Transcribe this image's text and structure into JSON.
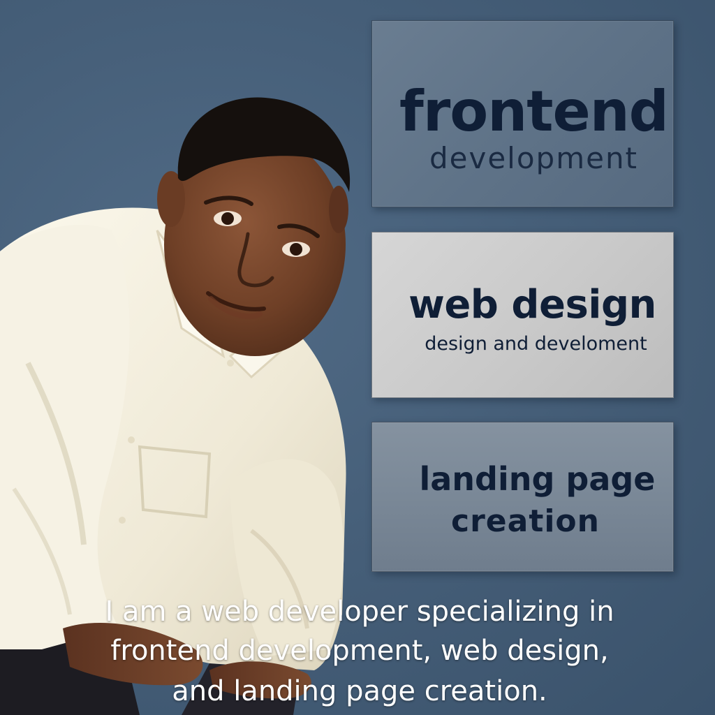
{
  "colors": {
    "background": "#4a627c",
    "card_dark_text": "#0f1e36",
    "caption_text": "#ffffff",
    "shirt": "#f4f0e2",
    "skin": "#7a4a2f"
  },
  "portrait": {
    "icon": "person-portrait"
  },
  "cards": [
    {
      "title": "frontend",
      "subtitle": "development"
    },
    {
      "title": "web design",
      "subtitle": "design and develoment"
    },
    {
      "title": "landing page",
      "subtitle": "creation"
    }
  ],
  "caption": {
    "line1": "I am a web developer specializing in",
    "line2": "frontend development, web design,",
    "line3": "and landing page creation."
  }
}
